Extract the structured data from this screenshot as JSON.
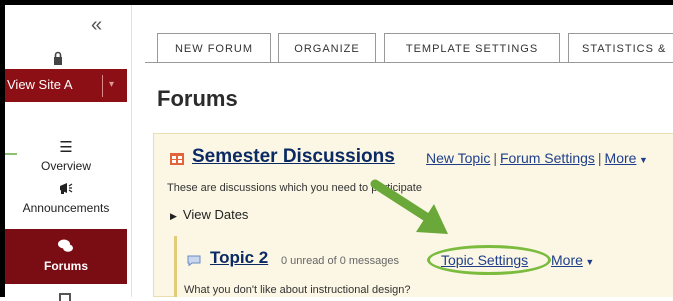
{
  "sidebar": {
    "collapse_glyph": "«",
    "view_site": "View Site A",
    "view_site_caret": "▾",
    "overview": "Overview",
    "announcements": "Announcements",
    "forums": "Forums"
  },
  "tabs": [
    "NEW FORUM",
    "ORGANIZE",
    "TEMPLATE SETTINGS",
    "STATISTICS &"
  ],
  "page_title": "Forums",
  "forum": {
    "title": "Semester Discussions",
    "new_topic": "New Topic",
    "forum_settings": "Forum Settings",
    "more": "More",
    "description": "These are discussions which you need to participate",
    "view_dates": "View Dates"
  },
  "topic": {
    "title": "Topic 2",
    "count": "0 unread of 0 messages",
    "settings": "Topic Settings",
    "more": "More",
    "description": "What you don't like about instructional design?"
  },
  "colors": {
    "brand_red": "#8b0f15",
    "highlight_green": "#7bbb3e",
    "link_blue": "#1f3f8a",
    "panel_bg": "#fbf7e4"
  }
}
